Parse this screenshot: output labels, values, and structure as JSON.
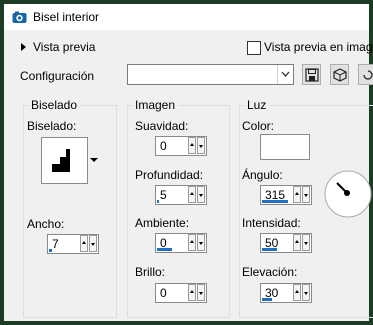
{
  "window": {
    "title": "Bisel interior",
    "app_icon": "app-icon"
  },
  "preview": {
    "label": "Vista previa",
    "live_label": "Vista previa en imagen",
    "live_checked": false
  },
  "config": {
    "label": "Configuración",
    "value": ""
  },
  "toolbar": {
    "icons": [
      "save-icon",
      "preset-icon",
      "reset-icon"
    ]
  },
  "bevel": {
    "group_title": "Biselado",
    "shape_label": "Biselado:",
    "width_label": "Ancho:",
    "width_value": "7",
    "width_level": 0.1
  },
  "image": {
    "group_title": "Imagen",
    "smoothness_label": "Suavidad:",
    "smoothness_value": "0",
    "smoothness_level": 0,
    "depth_label": "Profundidad:",
    "depth_value": "5",
    "depth_level": 0.05,
    "ambient_label": "Ambiente:",
    "ambient_value": "0",
    "ambient_level": 0.5,
    "brightness_label": "Brillo:",
    "brightness_value": "0",
    "brightness_level": 0
  },
  "light": {
    "group_title": "Luz",
    "color_label": "Color:",
    "color_value": "#ffffff",
    "angle_label": "Ángulo:",
    "angle_value": "315",
    "angle_level": 0.88,
    "intensity_label": "Intensidad:",
    "intensity_value": "50",
    "intensity_level": 0.5,
    "elevation_label": "Elevación:",
    "elevation_value": "30",
    "elevation_level": 0.33
  },
  "colors": {
    "frame": "#1d3b24",
    "accent": "#1e6fc0",
    "background": "#f0f0f0"
  }
}
